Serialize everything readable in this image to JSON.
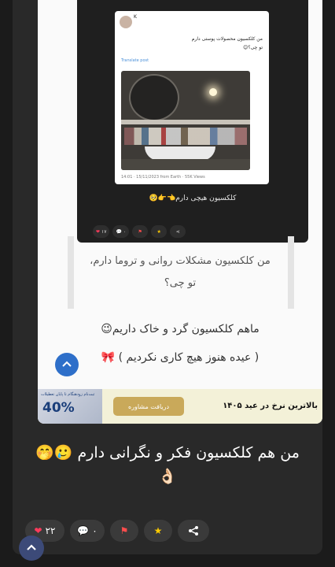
{
  "tweet": {
    "name": "K",
    "text_line1": "من کلکسیون محصولات پوستی دارم",
    "text_line2": "تو چی؟😊",
    "translate": "Translate post",
    "meta": "14:01 · 15/11/2023 from Earth · 55K Views"
  },
  "phone": {
    "caption": "کلکسیون هیچی دارم👈👉🥺",
    "likes": "۱۷",
    "comments": "۰"
  },
  "post": {
    "line1": "من کلکسیون مشکلات روانی و تروما دارم،",
    "line2": "تو چی؟",
    "quote1": "ماهم کلکسیون گرد و خاک داریم😉",
    "quote2": "( عیده هنوز هیچ کاری نکردیم ) 🎀"
  },
  "banner": {
    "small": "ثبت‌نام زودهنگام تا پایان تعطیلات",
    "percent": "40%",
    "button": "دریافت مشاوره",
    "text": "بالاترین نرخ در عید ۱۴۰۵"
  },
  "caption": {
    "line1": "من هم کلکسیون فکر و نگرانی دارم 🥲🤭",
    "line2": "👌🏻"
  },
  "actions": {
    "likes": "۲۲",
    "comments": "۰"
  },
  "colors": {
    "background": "#1b1b1b",
    "card": "#292929",
    "like": "#ff3b5c",
    "flag": "#ff4d4d",
    "star": "#ffcc00",
    "fab": "#3c4a78"
  }
}
